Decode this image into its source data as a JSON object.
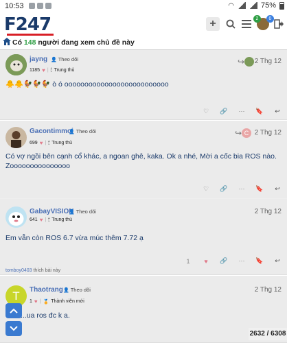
{
  "status_bar": {
    "time": "10:53",
    "battery": "75%"
  },
  "header": {
    "logo": "F247",
    "notif_count_green": "2",
    "notif_count_blue": "0"
  },
  "online": {
    "prefix": "Có",
    "count": "148",
    "suffix": "người đang xem chủ đề này"
  },
  "posts": [
    {
      "username": "jayng",
      "follow_label": "Theo dõi",
      "likes": "1185",
      "rank": "Trung thủ",
      "date": "2 Thg 12",
      "content": "🐥🐥🐓🐓🐓 ò ó oooooooooooooooooooooooooo"
    },
    {
      "username": "Gacontimmoi",
      "follow_label": "Theo dõi",
      "likes": "699",
      "rank": "Trung thủ",
      "date": "2 Thg 12",
      "reply_avatar_letter": "C",
      "content": "Có vợ ngồi bên cạnh cổ khác, a ngoan ghê, kaka. Ok a nhé, Mời a cốc bia ROS nào. Zooooooooooooooo"
    },
    {
      "username": "GabayVISION",
      "follow_label": "Theo dõi",
      "likes": "641",
      "rank": "Trung thủ",
      "date": "2 Thg 12",
      "content": "Em vẫn còn ROS 6.7 vừa múc thêm 7.72 ạ",
      "like_count": "1",
      "liked_by_user": "tomboy0403",
      "liked_by_text": "thích bài này"
    },
    {
      "username": "Thaotrang",
      "follow_label": "Theo dõi",
      "likes": "1",
      "rank": "Thành viên mới",
      "date": "2 Thg 12",
      "avatar_letter": "T",
      "content": "...ua ros đc k a."
    }
  ],
  "progress": {
    "current": "2632",
    "total": "6308",
    "label": "2632 / 6308"
  },
  "colors": {
    "accent": "#3a7ad0",
    "brand": "#1a3a6a",
    "brand_red": "#d81f26",
    "username": "#4a6fb5",
    "online_green": "#2e9e44"
  }
}
